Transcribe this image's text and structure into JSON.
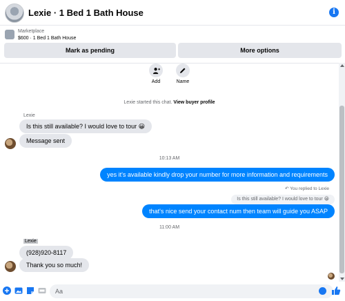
{
  "header": {
    "title": "Lexie · 1 Bed 1 Bath House",
    "info_icon": "info-icon",
    "accent": "#1877f2"
  },
  "listing": {
    "category": "Marketplace",
    "price_title": "$600 · 1 Bed 1 Bath House",
    "mark_pending_label": "Mark as pending",
    "more_options_label": "More options"
  },
  "actions": {
    "add_label": "Add",
    "name_label": "Name"
  },
  "chat": {
    "started_text": "Lexie started this chat.",
    "view_profile_label": "View buyer profile",
    "sender_name": "Lexie",
    "msg1": "Is this still available? I would love to tour 😀",
    "msg2": "Message sent",
    "time1": "10:13 AM",
    "out1": "yes it's available kindly drop your number for more information and requirements",
    "replied_label": "You replied to Lexie",
    "quoted": "Is this still available? I would love to tour 😀",
    "out2": "that's nice send your contact num then team will guide you ASAP",
    "time2": "11:00 AM",
    "sender_tag": "Lexie",
    "msg3": "(928)920-8117",
    "msg4": "Thank you so much!"
  },
  "composer": {
    "placeholder": "Aa"
  },
  "colors": {
    "outgoing": "#0084ff",
    "incoming": "#e4e6eb"
  }
}
